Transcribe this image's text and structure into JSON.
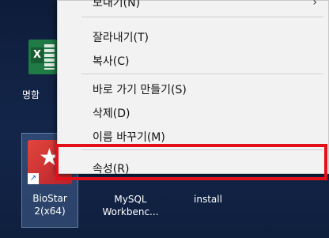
{
  "desktop": {
    "icons": [
      {
        "label": "명함"
      },
      {
        "label": "BioStar 2(x64)"
      },
      {
        "label": "MySQL Workbenc..."
      },
      {
        "label": "install"
      }
    ]
  },
  "context_menu": {
    "top_item_partial": "보내기(N)",
    "items": [
      {
        "label": "잘라내기(T)"
      },
      {
        "label": "복사(C)"
      },
      {
        "label": "바로 가기 만들기(S)"
      },
      {
        "label": "삭제(D)"
      },
      {
        "label": "이름 바꾸기(M)"
      },
      {
        "label": "속성(R)"
      }
    ]
  },
  "highlight_color": "#e3101a"
}
